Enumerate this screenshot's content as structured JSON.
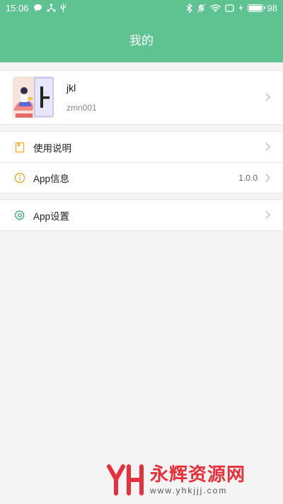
{
  "status_bar": {
    "time": "15:06",
    "battery_level": "98",
    "icons_left": [
      "chat-bubble-icon",
      "share-icon",
      "usb-icon"
    ],
    "icons_right": [
      "bluetooth-icon",
      "mute-icon",
      "wifi-icon",
      "window-icon",
      "charging-icon",
      "battery-icon"
    ]
  },
  "header": {
    "title": "我的"
  },
  "profile": {
    "name": "jkl",
    "id": "zmn001"
  },
  "menu_group_1": [
    {
      "label": "使用说明",
      "icon": "book-icon",
      "value": ""
    },
    {
      "label": "App信息",
      "icon": "info-icon",
      "value": "1.0.0"
    }
  ],
  "menu_group_2": [
    {
      "label": "App设置",
      "icon": "gear-icon",
      "value": ""
    }
  ],
  "watermark": {
    "logo_text": "YH",
    "name": "永辉资源网",
    "url": "www.yhkjjj.com"
  },
  "colors": {
    "primary": "#5ec391",
    "book_icon": "#f3b63a",
    "info_icon": "#f0a828",
    "gear_icon": "#3aa776",
    "watermark": "#e8303a"
  }
}
